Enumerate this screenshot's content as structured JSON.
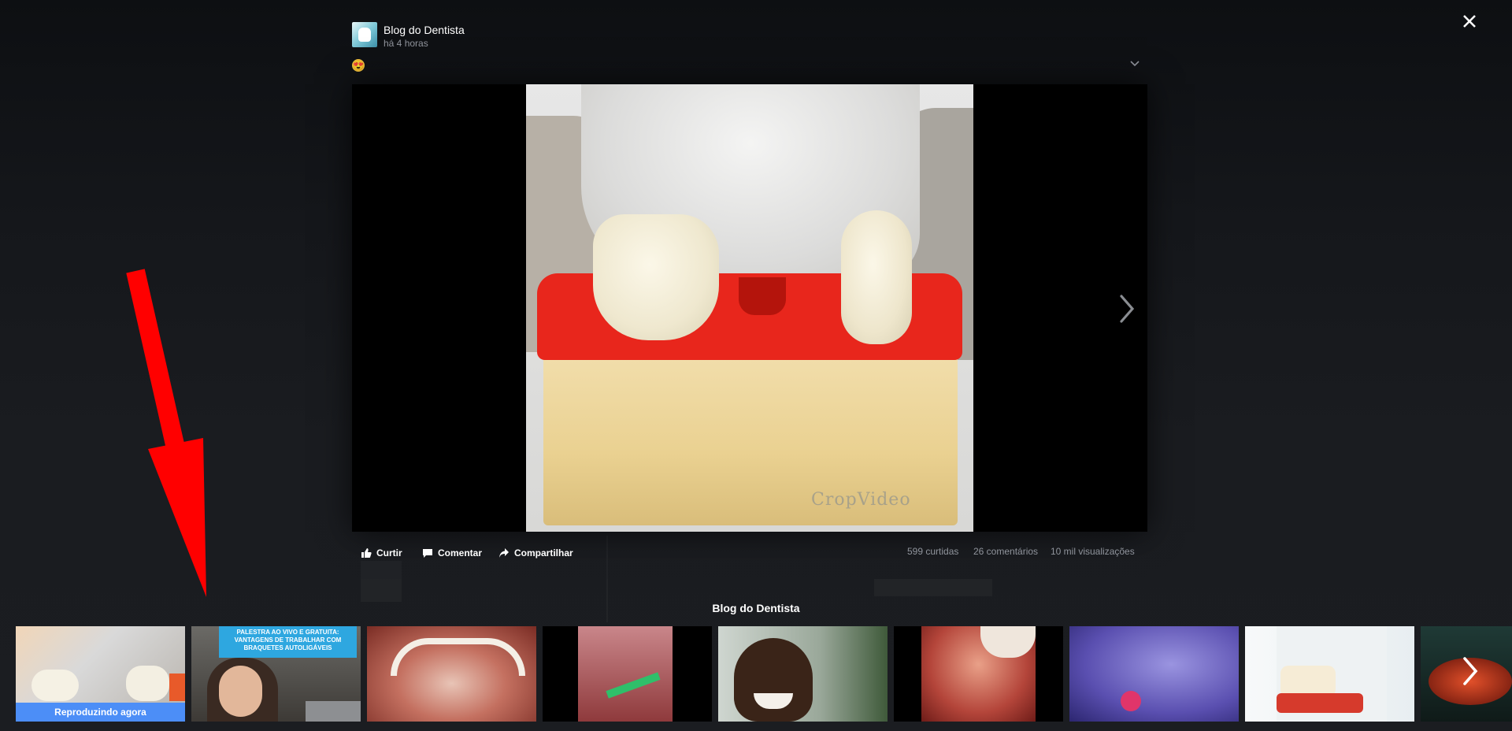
{
  "post": {
    "page_name": "Blog do Dentista",
    "timestamp": "há 4 horas",
    "emoji": "😍"
  },
  "video": {
    "watermark": "CropVideo"
  },
  "actions": {
    "like": "Curtir",
    "comment": "Comentar",
    "share": "Compartilhar"
  },
  "stats": {
    "likes": "599 curtidas",
    "comments": "26 comentários",
    "views": "10 mil visualizações"
  },
  "playlist": {
    "title": "Blog do Dentista",
    "now_playing_label": "Reproduzindo agora",
    "banner_line1": "PALESTRA AO VIVO E GRATUITA:",
    "banner_line2": "VANTAGENS DE TRABALHAR COM",
    "banner_line3": "BRAQUETES AUTOLIGÁVEIS"
  },
  "icons": {
    "close": "close-icon",
    "next": "chevron-right-icon",
    "annotation": "red-arrow-annotation"
  },
  "colors": {
    "now_playing": "#4c8ef7",
    "annotation": "#ff0000",
    "banner": "#2ea7e0"
  }
}
